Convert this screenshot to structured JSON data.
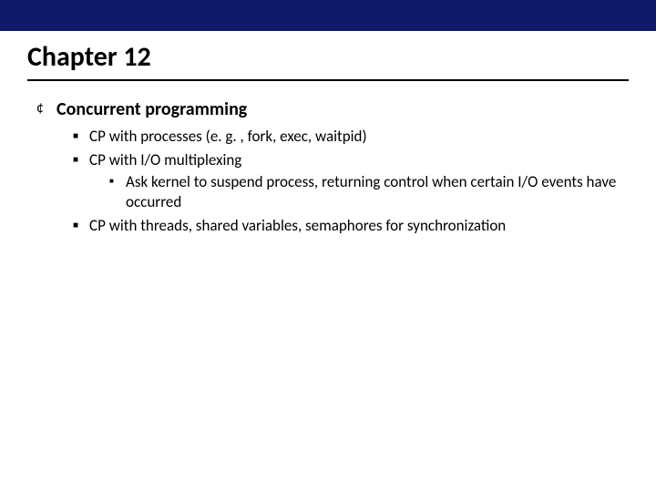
{
  "title": "Chapter 12",
  "section": {
    "heading": "Concurrent programming",
    "items": [
      {
        "text": "CP with processes (e. g. , fork, exec, waitpid)"
      },
      {
        "text": "CP with I/O multiplexing",
        "sub": [
          {
            "text": "Ask kernel to suspend process, returning control when certain I/O events have occurred"
          }
        ]
      },
      {
        "text": "CP with threads, shared variables, semaphores for synchronization"
      }
    ]
  }
}
